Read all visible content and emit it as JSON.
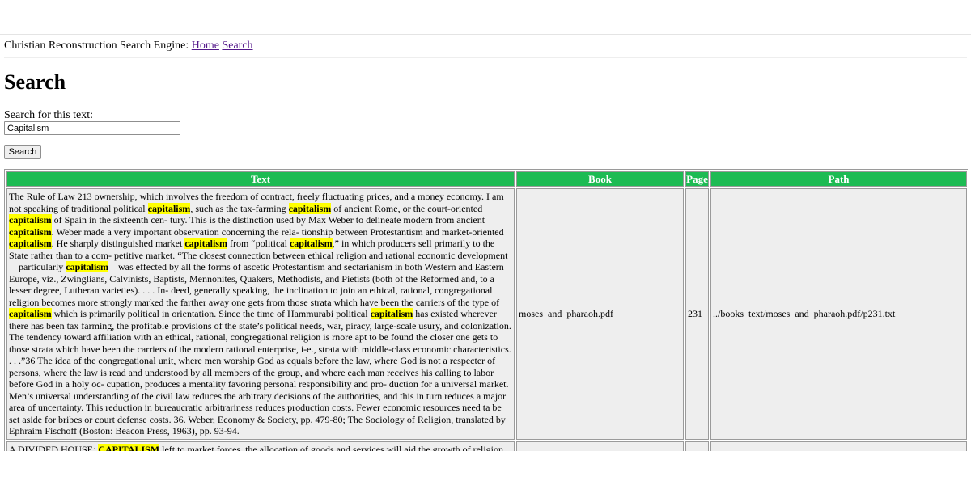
{
  "nav": {
    "prefix": "Christian Reconstruction Search Engine:",
    "home_link": "Home",
    "search_link": "Search"
  },
  "page_title": "Search",
  "search": {
    "label": "Search for this text:",
    "value": "Capitalism",
    "button_label": "Search"
  },
  "table": {
    "headers": {
      "text": "Text",
      "book": "Book",
      "page": "Page",
      "path": "Path"
    },
    "rows": [
      {
        "text_segments": [
          "The Rule of Law 213 ownership, which involves the freedom of contract, freely fluctuating prices, and a money economy. I am not speaking of traditional political ",
          "capitalism",
          ", such as the tax-farming ",
          "capitalism",
          " of ancient Rome, or the court-oriented ",
          "capitalism",
          " of Spain in the sixteenth cen- tury. This is the distinction used by Max Weber to delineate modern from ancient ",
          "capitalism",
          ". Weber made a very important observation concerning the rela- tionship between Protestantism and market-oriented ",
          "capitalism",
          ". He sharply distinguished market ",
          "capitalism",
          " from “political ",
          "capitalism",
          ",” in which producers sell primarily to the State rather than to a com- petitive market. “The closest connection between ethical religion and rational economic development—particularly ",
          "capitalism",
          "—was effected by all the forms of ascetic Protestantism and sectarianism in both Western and Eastern Europe, viz., Zwinglians, Calvinists, Baptists, Mennonites, Quakers, Methodists, and Pietists (both of the Reformed and, to a lesser degree, Lutheran varieties). . . . In- deed, generally speaking, the inclination to join an ethical, rational, congregational religion becomes more strongly marked the farther away one gets from those strata which have been the carriers of the type of ",
          "capitalism",
          " which is primarily political in orientation. Since the time of Hammurabi political ",
          "capitalism",
          " has existed wherever there has been tax farming, the profitable provisions of the state’s political needs, war, piracy, large-scale usury, and colonization. The tendency toward affiliation with an ethical, rational, congregational religion is rnore apt to be found the closer one gets to those strata which have been the carriers of the modern rational enterprise, i-e., strata with middle-class economic characteristics. . . .”36 The idea of the congregational unit, where men worship God as equals before the law, where God is not a respecter of persons, where the law is read and understood by all members of the group, and where each man receives his calling to labor before God in a holy oc- cupation, produces a mentality favoring personal responsibility and pro- duction for a universal market. Men’s universal understanding of the civil law reduces the arbitrary decisions of the authorities, and this in turn reduces a major area of uncertainty. This reduction in bureaucratic arbitrariness reduces production costs. Fewer economic resources need ta be set aside for bribes or court defense costs. 36. Weber, Economy & Society, pp. 479-80; The Sociology of Religion, translated by Ephraim Fischoff (Boston: Beacon Press, 1963), pp. 93-94."
        ],
        "book": "moses_and_pharaoh.pdf",
        "page": "231",
        "path": "../books_text/moses_and_pharaoh.pdf/p231.txt"
      }
    ],
    "partial_row": {
      "text_segments": [
        "A DIVIDED HOUSE: ",
        "CAPITALISM",
        " left to market forces, the allocation of goods and services will aid the growth of religion and..."
      ],
      "book": "",
      "page": "",
      "path": ""
    }
  }
}
